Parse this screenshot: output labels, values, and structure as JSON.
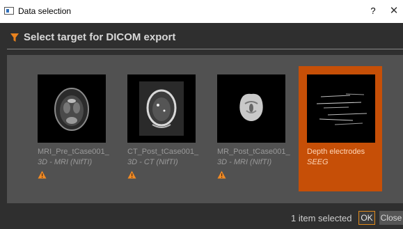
{
  "window": {
    "title": "Data selection",
    "help_label": "?",
    "close_glyph": "✕"
  },
  "header": {
    "title": "Select target for DICOM export",
    "icon": "filter-icon",
    "accent_color": "#e8821e"
  },
  "items": [
    {
      "name": "MRI_Pre_tCase001_",
      "type": "3D - MRI (NIfTI)",
      "warning": true,
      "selected": false,
      "thumbnail": "axial-brain-mri"
    },
    {
      "name": "CT_Post_tCase001_",
      "type": "3D - CT (NIfTI)",
      "warning": true,
      "selected": false,
      "thumbnail": "axial-head-ct"
    },
    {
      "name": "MR_Post_tCase001_",
      "type": "3D - MRI (NIfTI)",
      "warning": true,
      "selected": false,
      "thumbnail": "axial-brain-mri-small"
    },
    {
      "name": "Depth electrodes",
      "type": "SEEG",
      "warning": false,
      "selected": true,
      "thumbnail": "electrode-lines"
    }
  ],
  "footer": {
    "status": "1 item selected",
    "ok_label": "OK",
    "close_label": "Close"
  },
  "colors": {
    "dialog_bg": "#2f2f2f",
    "grid_bg": "#515151",
    "selection": "#c64f07",
    "warning": "#f08a24"
  }
}
